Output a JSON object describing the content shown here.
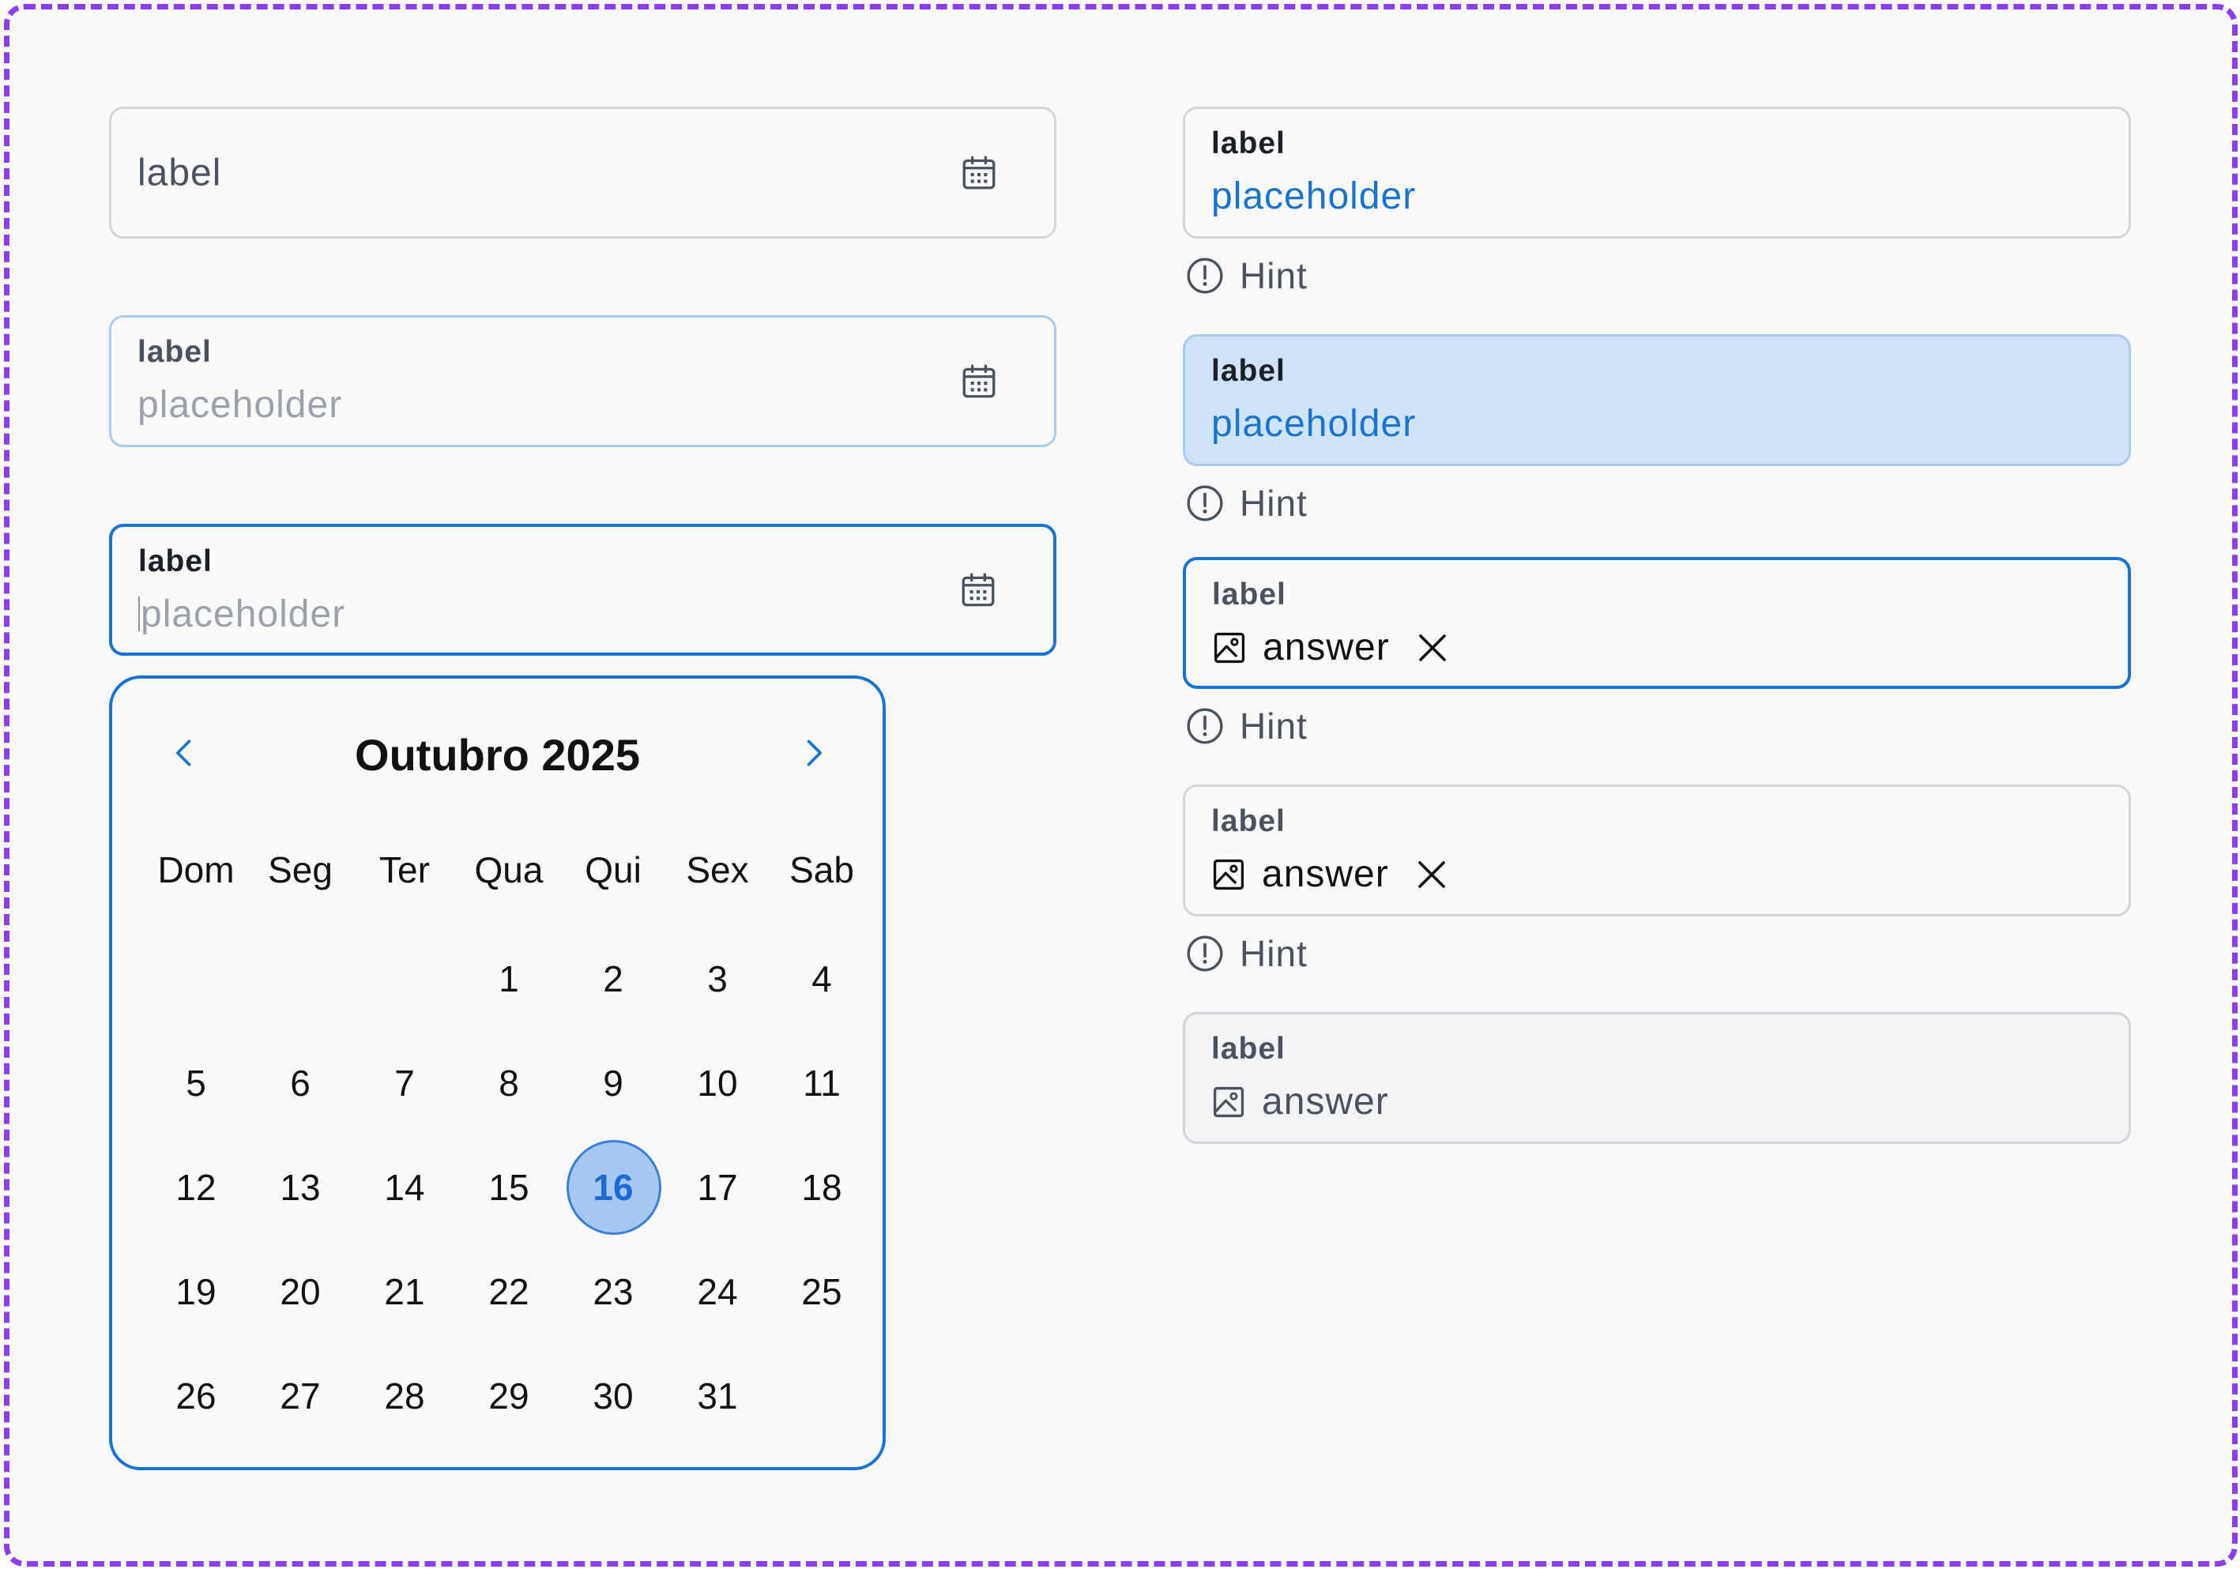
{
  "left": {
    "field1": {
      "label": "label"
    },
    "field2": {
      "label": "label",
      "placeholder": "placeholder"
    },
    "field3": {
      "label": "label",
      "placeholder": "placeholder"
    }
  },
  "calendar": {
    "title": "Outubro 2025",
    "weekdays": [
      "Dom",
      "Seg",
      "Ter",
      "Qua",
      "Qui",
      "Sex",
      "Sab"
    ],
    "weeks": [
      [
        "",
        "",
        "",
        "1",
        "2",
        "3",
        "4"
      ],
      [
        "5",
        "6",
        "7",
        "8",
        "9",
        "10",
        "11"
      ],
      [
        "12",
        "13",
        "14",
        "15",
        "16",
        "17",
        "18"
      ],
      [
        "19",
        "20",
        "21",
        "22",
        "23",
        "24",
        "25"
      ],
      [
        "26",
        "27",
        "28",
        "29",
        "30",
        "31",
        ""
      ]
    ],
    "selected_day": "16"
  },
  "right": {
    "field1": {
      "label": "label",
      "placeholder": "placeholder",
      "hint": "Hint"
    },
    "field2": {
      "label": "label",
      "placeholder": "placeholder",
      "hint": "Hint"
    },
    "field3": {
      "label": "label",
      "answer": "answer",
      "hint": "Hint"
    },
    "field4": {
      "label": "label",
      "answer": "answer",
      "hint": "Hint"
    },
    "field5": {
      "label": "label",
      "answer": "answer"
    }
  },
  "colors": {
    "accent": "#1a73d1",
    "frame": "#8b3ff0",
    "selected_fill": "#cfe3f8",
    "muted_text": "#4a5260"
  },
  "icons": [
    "calendar-icon",
    "chevron-left-icon",
    "chevron-right-icon",
    "alert-circle-icon",
    "image-icon",
    "close-icon"
  ]
}
